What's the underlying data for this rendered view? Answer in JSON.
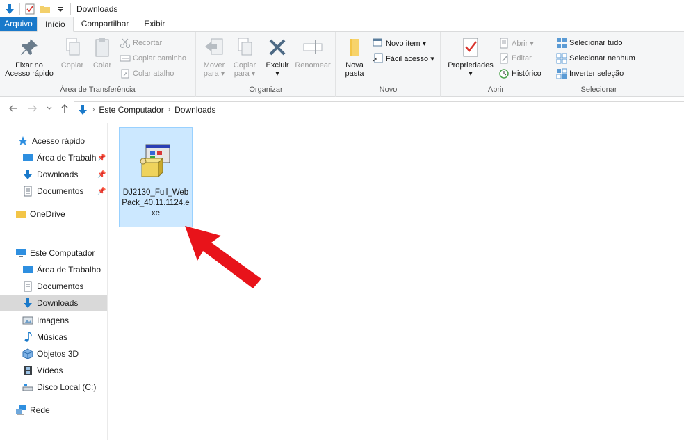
{
  "window": {
    "title": "Downloads"
  },
  "ribbon_tabs": [
    {
      "label": "Arquivo"
    },
    {
      "label": "Início"
    },
    {
      "label": "Compartilhar"
    },
    {
      "label": "Exibir"
    }
  ],
  "ribbon": {
    "clipboard": {
      "group_label": "Área de Transferência",
      "pin_label_1": "Fixar no",
      "pin_label_2": "Acesso rápido",
      "copy_label": "Copiar",
      "paste_label": "Colar",
      "cut_label": "Recortar",
      "copy_path_label": "Copiar caminho",
      "paste_shortcut_label": "Colar atalho"
    },
    "organize": {
      "group_label": "Organizar",
      "move_label_1": "Mover",
      "move_label_2": "para ▾",
      "copyto_label_1": "Copiar",
      "copyto_label_2": "para ▾",
      "delete_label_1": "Excluir",
      "delete_label_2": "▾",
      "rename_label": "Renomear"
    },
    "new": {
      "group_label": "Novo",
      "new_folder_label_1": "Nova",
      "new_folder_label_2": "pasta",
      "new_item_label": "Novo item ▾",
      "easy_access_label": "Fácil acesso ▾"
    },
    "open": {
      "group_label": "Abrir",
      "properties_label_1": "Propriedades",
      "properties_label_2": "▾",
      "open_label": "Abrir ▾",
      "edit_label": "Editar",
      "history_label": "Histórico"
    },
    "select": {
      "group_label": "Selecionar",
      "select_all_label": "Selecionar tudo",
      "select_none_label": "Selecionar nenhum",
      "invert_label": "Inverter seleção"
    }
  },
  "address": {
    "crumbs": [
      "Este Computador",
      "Downloads"
    ]
  },
  "sidebar": {
    "quick_access": "Acesso rápido",
    "quick_items": [
      "Área de Trabalh",
      "Downloads",
      "Documentos"
    ],
    "onedrive": "OneDrive",
    "this_pc": "Este Computador",
    "pc_items": [
      "Área de Trabalho",
      "Documentos",
      "Downloads",
      "Imagens",
      "Músicas",
      "Objetos 3D",
      "Vídeos",
      "Disco Local (C:)"
    ],
    "network": "Rede"
  },
  "files": [
    {
      "name": "DJ2130_Full_WebPack_40.11.1124.exe"
    }
  ],
  "colors": {
    "accent": "#1979ca",
    "selection": "#cce8ff",
    "arrow": "#e8131a"
  }
}
